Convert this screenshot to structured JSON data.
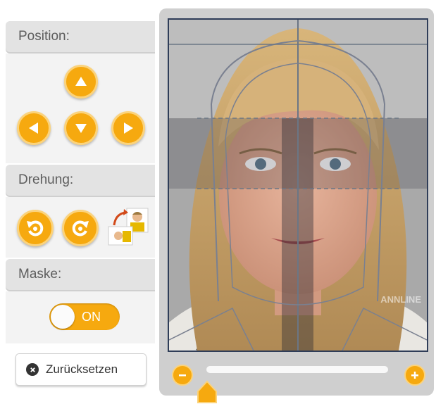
{
  "sections": {
    "position": {
      "title": "Position:"
    },
    "rotation": {
      "title": "Drehung:"
    },
    "mask": {
      "title": "Maske:",
      "toggle_label": "ON",
      "toggle_state": true
    }
  },
  "reset_button": {
    "label": "Zurücksetzen"
  },
  "photo": {
    "watermark": "ANNLINE"
  },
  "zoom": {
    "level": 0.05
  },
  "icons": {
    "up": "arrow-up-icon",
    "left": "arrow-left-icon",
    "down": "arrow-down-icon",
    "right": "arrow-right-icon",
    "rotate_left": "rotate-left-icon",
    "rotate_right": "rotate-right-icon",
    "swap": "swap-orientation-icon",
    "zoom_out": "minus-icon",
    "zoom_in": "plus-icon",
    "reset": "close-circle-icon"
  },
  "colors": {
    "accent": "#f6a90f",
    "header": "#e3e3e3",
    "frame": "#cfcfcf",
    "outline": "#2f3d58"
  }
}
